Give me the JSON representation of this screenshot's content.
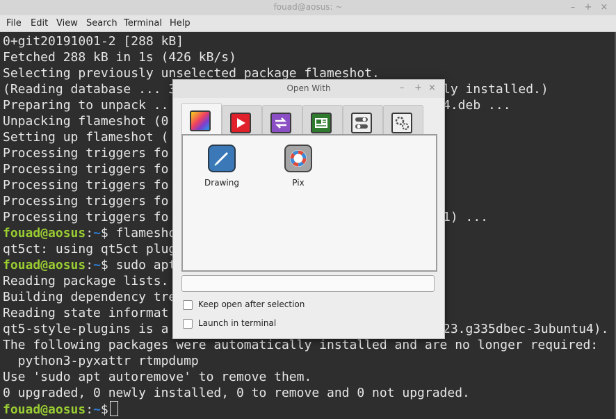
{
  "terminal": {
    "title": "fouad@aosus: ~",
    "controls": {
      "minimize": "–",
      "maximize": "+",
      "close": "×"
    },
    "menu": [
      "File",
      "Edit",
      "View",
      "Search",
      "Terminal",
      "Help"
    ],
    "lines": [
      "0+git20191001-2 [288 kB]",
      "Fetched 288 kB in 1s (426 kB/s)",
      "Selecting previously unselected package flameshot.",
      "(Reading database ... 3",
      "Preparing to unpack ..",
      "Unpacking flameshot (0",
      "Setting up flameshot (",
      "Processing triggers fo",
      "Processing triggers fo",
      "Processing triggers fo",
      "Processing triggers fo",
      "Processing triggers fo"
    ],
    "tail_fragments": [
      "ly installed.)",
      "4.deb ...",
      "1) ..."
    ],
    "prompt1": {
      "user": "fouad@aosus",
      "sep": ":",
      "path": "~",
      "sym": "$",
      "cmd": " flamesho"
    },
    "qt_line": "qt5ct: using qt5ct plug",
    "prompt2": {
      "user": "fouad@aosus",
      "sep": ":",
      "path": "~",
      "sym": "$",
      "cmd": " sudo apt"
    },
    "lines2": [
      "Reading package lists.",
      "Building dependency tre",
      "Reading state informat",
      "qt5-style-plugins is a"
    ],
    "tail_fragment2": "23.g335dbec-3ubuntu4).",
    "lines3": [
      "The following packages were automatically installed and are no longer required:",
      "  python3-pyxattr rtmpdump",
      "Use 'sudo apt autoremove' to remove them.",
      "0 upgraded, 0 newly installed, 0 to remove and 0 not upgraded."
    ],
    "prompt3": {
      "user": "fouad@aosus",
      "sep": ":",
      "path": "~",
      "sym": "$"
    }
  },
  "dialog": {
    "title": "Open With",
    "controls": {
      "minimize": "–",
      "maximize": "+",
      "close": "×"
    },
    "tabs": [
      {
        "icon": "graphics-icon",
        "color": "#e03a7a"
      },
      {
        "icon": "multimedia-icon",
        "color": "#e0202a"
      },
      {
        "icon": "sharing-icon",
        "color": "#8a4fc4"
      },
      {
        "icon": "office-icon",
        "color": "#2f7a2f"
      },
      {
        "icon": "settings-toggle-icon",
        "color": "#e8e8e8"
      },
      {
        "icon": "preferences-gears-icon",
        "color": "#e8e8e8"
      }
    ],
    "apps": [
      {
        "label": "Drawing",
        "icon": "drawing-app-icon",
        "color": "#3a78b8"
      },
      {
        "label": "Pix",
        "icon": "pix-app-icon",
        "color": "#9a9a9a"
      }
    ],
    "command_value": "",
    "options": [
      "Keep open after selection",
      "Launch in terminal"
    ]
  }
}
